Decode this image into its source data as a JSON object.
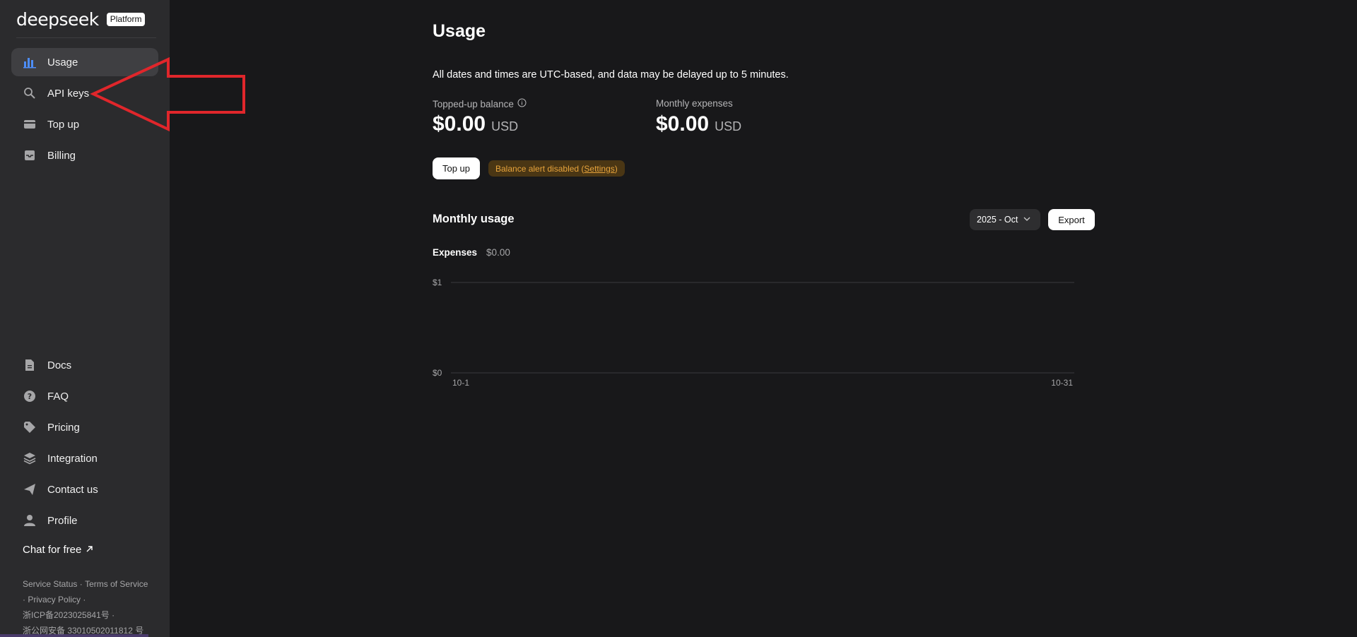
{
  "brand": {
    "logo": "deepseek",
    "badge": "Platform"
  },
  "sidebar": {
    "top_items": [
      {
        "label": "Usage",
        "icon": "bar-chart-icon",
        "active": true
      },
      {
        "label": "API keys",
        "icon": "search-key-icon",
        "active": false
      },
      {
        "label": "Top up",
        "icon": "card-icon",
        "active": false
      },
      {
        "label": "Billing",
        "icon": "inbox-icon",
        "active": false
      }
    ],
    "bottom_items": [
      {
        "label": "Docs",
        "icon": "doc-icon"
      },
      {
        "label": "FAQ",
        "icon": "question-icon"
      },
      {
        "label": "Pricing",
        "icon": "tag-icon"
      },
      {
        "label": "Integration",
        "icon": "layers-icon"
      },
      {
        "label": "Contact us",
        "icon": "send-icon"
      },
      {
        "label": "Profile",
        "icon": "user-icon"
      }
    ],
    "chat_free": "Chat for free",
    "footer": {
      "service_status": "Service Status",
      "terms": "Terms of Service",
      "privacy": "Privacy Policy",
      "icp": "浙ICP备2023025841号",
      "police": "浙公网安备 33010502011812 号"
    }
  },
  "main": {
    "title": "Usage",
    "note": "All dates and times are UTC-based, and data may be delayed up to 5 minutes.",
    "topped_up": {
      "label": "Topped-up balance",
      "amount": "$0.00",
      "currency": "USD"
    },
    "monthly_expenses": {
      "label": "Monthly expenses",
      "amount": "$0.00",
      "currency": "USD"
    },
    "topup_button": "Top up",
    "alert": {
      "text": "Balance alert disabled (",
      "link": "Settings",
      "close": ")"
    },
    "monthly_usage": {
      "title": "Monthly usage",
      "month_select": "2025 - Oct",
      "export_button": "Export",
      "expenses_label": "Expenses",
      "expenses_value": "$0.00"
    }
  },
  "chart_data": {
    "type": "line",
    "x_ticks": [
      "10-1",
      "10-31"
    ],
    "y_ticks": [
      "$1",
      "$0"
    ],
    "ylim": [
      0,
      1
    ],
    "series": [],
    "grid": true
  },
  "colors": {
    "background": "#18181a",
    "sidebar": "#2b2b2d",
    "accent_icon": "#4d8df7",
    "alert_text": "#e8a43c",
    "arrow": "#e0262b"
  }
}
